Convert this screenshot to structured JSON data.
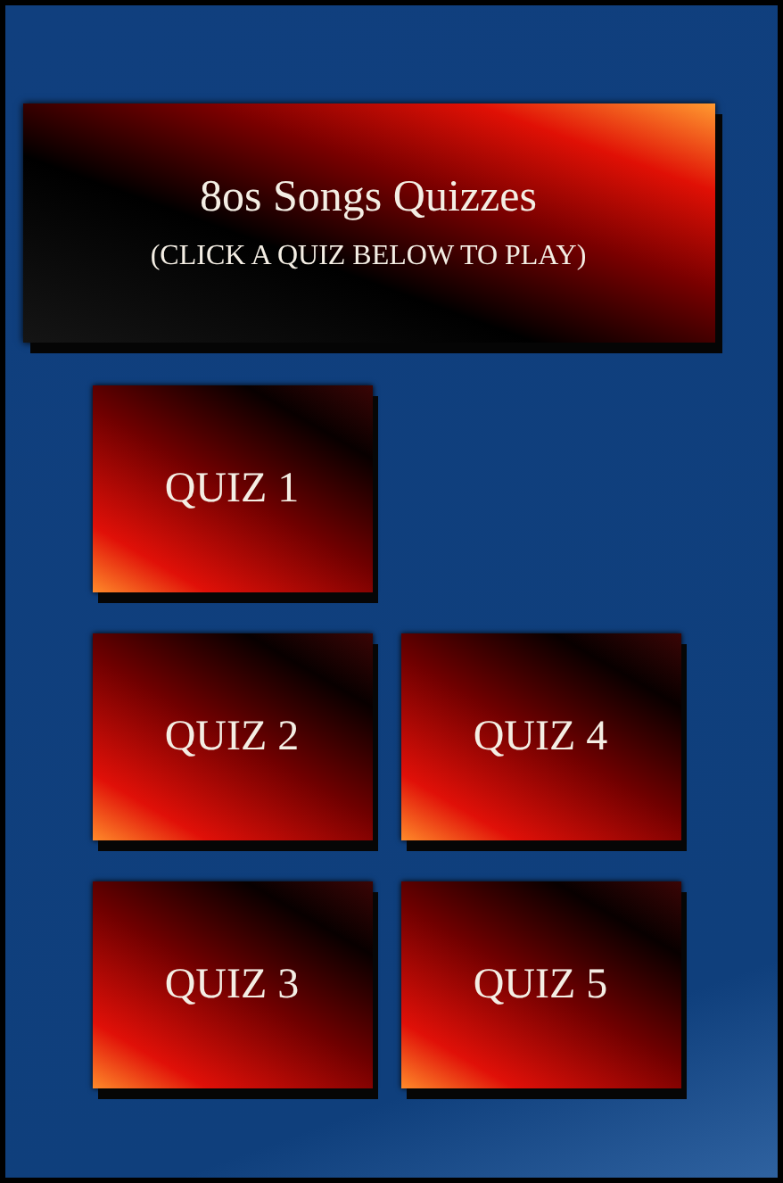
{
  "header": {
    "title": "8os Songs Quizzes",
    "subtitle": "(CLICK A QUIZ BELOW TO PLAY)"
  },
  "quiz_rows": [
    [
      "QUIZ 1"
    ],
    [
      "QUIZ 2",
      "QUIZ 4"
    ],
    [
      "QUIZ 3",
      "QUIZ 5"
    ]
  ]
}
